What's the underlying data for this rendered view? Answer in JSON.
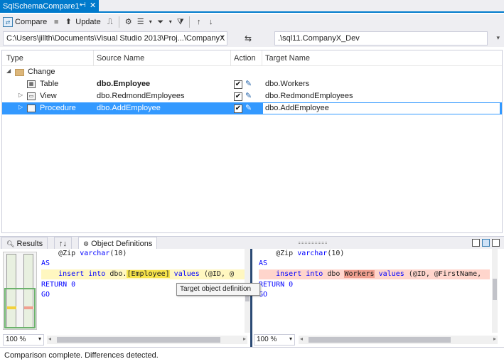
{
  "tab": {
    "title": "SqlSchemaCompare1*",
    "pin": "⊣",
    "close": "✕"
  },
  "toolbar": {
    "compare_label": "Compare",
    "update_label": "Update"
  },
  "paths": {
    "source": "C:\\Users\\jillth\\Documents\\Visual Studio 2013\\Proj...\\CompanyX",
    "swap": "⇆",
    "target": ".\\sql11.CompanyX_Dev"
  },
  "grid": {
    "headers": {
      "type": "Type",
      "source": "Source Name",
      "action": "Action",
      "target": "Target Name"
    },
    "group": {
      "label": "Change"
    },
    "rows": [
      {
        "type": "Table",
        "source": "dbo.Employee",
        "target": "dbo.Workers",
        "checked": true
      },
      {
        "type": "View",
        "source": "dbo.RedmondEmployees",
        "target": "dbo.RedmondEmployees",
        "checked": true
      },
      {
        "type": "Procedure",
        "source": "dbo.AddEmployee",
        "target": "dbo.AddEmployee",
        "checked": true
      }
    ]
  },
  "lower": {
    "tabs": {
      "results": "Results",
      "sort": "↑↓",
      "object_definitions": "Object Definitions"
    }
  },
  "source_code": {
    "line1_pre": "    @Zip ",
    "line1_type": "varchar",
    "line1_post": "(10)",
    "line2": "AS",
    "line3_indent": "    ",
    "line3_kw1": "insert into",
    "line3_mid": " dbo.",
    "line3_hl": "[Employee]",
    "line3_kw2": " values",
    "line3_tail": " (@ID, @",
    "line4": "RETURN 0",
    "line5": "GO"
  },
  "target_code": {
    "line1_pre": "    @Zip ",
    "line1_type": "varchar",
    "line1_post": "(10)",
    "line2": "AS",
    "line3_indent": "    ",
    "line3_kw1": "insert into",
    "line3_mid": " dbo ",
    "line3_hl": "Workers",
    "line3_kw2": " values",
    "line3_tail": " (@ID, @FirstName, ",
    "line4": "RETURN 0",
    "line5": "GO"
  },
  "tooltip": "Target object definition",
  "zoom": {
    "left": "100 %",
    "right": "100 %"
  },
  "status": "Comparison complete.  Differences detected.",
  "colors": {
    "accent": "#007acc",
    "selection": "#3399ff",
    "source_highlight": "#f7e44a",
    "target_highlight": "#f0a090"
  }
}
